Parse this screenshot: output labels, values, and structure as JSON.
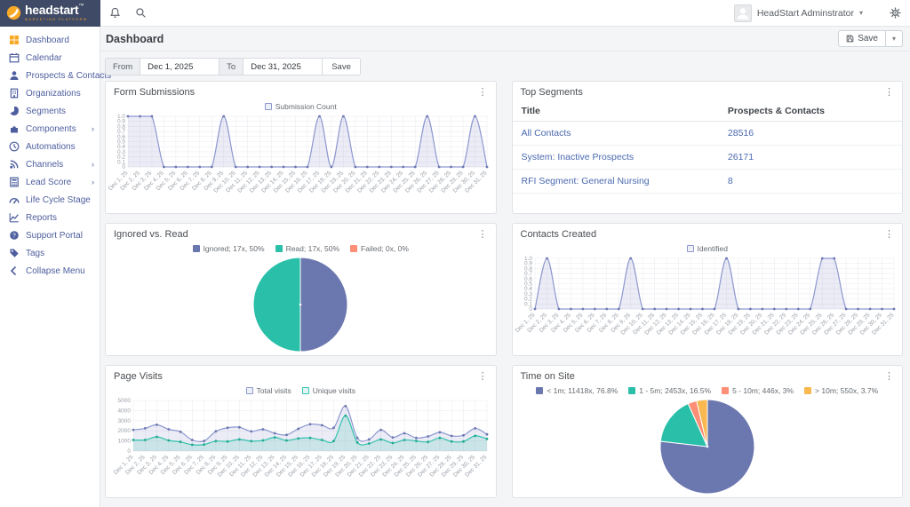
{
  "brand": {
    "name": "headstart",
    "trademark": "™",
    "tagline": "MARKETING PLATFORM"
  },
  "topbar": {
    "user": "HeadStart Adminstrator"
  },
  "sidebar": {
    "items": [
      {
        "label": "Dashboard",
        "icon": "dashboard-grid-icon",
        "active": true
      },
      {
        "label": "Calendar",
        "icon": "calendar-icon"
      },
      {
        "label": "Prospects & Contacts",
        "icon": "person-icon"
      },
      {
        "label": "Organizations",
        "icon": "building-icon"
      },
      {
        "label": "Segments",
        "icon": "pie-icon"
      },
      {
        "label": "Components",
        "icon": "puzzle-icon",
        "submenu": true
      },
      {
        "label": "Automations",
        "icon": "clock-icon"
      },
      {
        "label": "Channels",
        "icon": "broadcast-icon",
        "submenu": true
      },
      {
        "label": "Lead Score",
        "icon": "calculator-icon",
        "submenu": true
      },
      {
        "label": "Life Cycle Stage",
        "icon": "gauge-icon"
      },
      {
        "label": "Reports",
        "icon": "chart-line-icon"
      },
      {
        "label": "Support Portal",
        "icon": "help-icon"
      },
      {
        "label": "Tags",
        "icon": "tag-icon"
      },
      {
        "label": "Collapse Menu",
        "icon": "collapse-icon"
      }
    ]
  },
  "page": {
    "title": "Dashboard",
    "save_label": "Save"
  },
  "date_filter": {
    "from_label": "From",
    "from_value": "Dec 1, 2025",
    "to_label": "To",
    "to_value": "Dec 31, 2025",
    "apply_label": "Save"
  },
  "colors": {
    "purple": "#6b77af",
    "teal": "#29bfa8",
    "salmon": "#fc8f75",
    "yellow": "#f9b850",
    "line_purple": "#8e98cf",
    "accent_orange": "#f9a826",
    "sidebar_blue": "#4d5e9e",
    "link_blue": "#4a69b0"
  },
  "widgets": {
    "form_submissions": {
      "title": "Form Submissions"
    },
    "top_segments": {
      "title": "Top Segments",
      "columns": [
        "Title",
        "Prospects & Contacts"
      ],
      "rows": [
        {
          "title": "All Contacts",
          "count": "28516"
        },
        {
          "title": "System: Inactive Prospects",
          "count": "26171"
        },
        {
          "title": "RFI Segment: General Nursing",
          "count": "8"
        }
      ]
    },
    "ignored_vs_read": {
      "title": "Ignored vs. Read"
    },
    "contacts_created": {
      "title": "Contacts Created"
    },
    "page_visits": {
      "title": "Page Visits"
    },
    "time_on_site": {
      "title": "Time on Site"
    }
  },
  "x_labels": [
    "Dec 1, 25",
    "Dec 2, 25",
    "Dec 3, 25",
    "Dec 4, 25",
    "Dec 5, 25",
    "Dec 6, 25",
    "Dec 7, 25",
    "Dec 8, 25",
    "Dec 9, 25",
    "Dec 10, 25",
    "Dec 11, 25",
    "Dec 12, 25",
    "Dec 13, 25",
    "Dec 14, 25",
    "Dec 15, 25",
    "Dec 16, 25",
    "Dec 17, 25",
    "Dec 18, 25",
    "Dec 19, 25",
    "Dec 20, 25",
    "Dec 21, 25",
    "Dec 22, 25",
    "Dec 23, 25",
    "Dec 24, 25",
    "Dec 25, 25",
    "Dec 26, 25",
    "Dec 27, 25",
    "Dec 28, 25",
    "Dec 29, 25",
    "Dec 30, 25",
    "Dec 31, 25"
  ],
  "chart_data": [
    {
      "id": "form_submissions",
      "type": "area",
      "title": "Form Submissions",
      "x_ref": "x_labels",
      "ylim": [
        0,
        1
      ],
      "ystep": 0.1,
      "grid": true,
      "legend_position": "top",
      "series": [
        {
          "name": "Submission Count",
          "color": "#8e98cf",
          "point_color": "#6b77af",
          "values": [
            1,
            1,
            1,
            0,
            0,
            0,
            0,
            0,
            1,
            0,
            0,
            0,
            0,
            0,
            0,
            0,
            1,
            0,
            1,
            0,
            0,
            0,
            0,
            0,
            0,
            1,
            0,
            0,
            0,
            1,
            0
          ]
        }
      ]
    },
    {
      "id": "contacts_created",
      "type": "area",
      "title": "Contacts Created",
      "x_ref": "x_labels",
      "ylim": [
        0,
        1
      ],
      "ystep": 0.1,
      "grid": true,
      "legend_position": "top",
      "series": [
        {
          "name": "Identified",
          "color": "#8e98cf",
          "point_color": "#6b77af",
          "values": [
            0,
            1,
            0,
            0,
            0,
            0,
            0,
            0,
            1,
            0,
            0,
            0,
            0,
            0,
            0,
            0,
            1,
            0,
            0,
            0,
            0,
            0,
            0,
            0,
            1,
            1,
            0,
            0,
            0,
            0,
            0
          ]
        }
      ]
    },
    {
      "id": "page_visits",
      "type": "area",
      "title": "Page Visits",
      "x_ref": "x_labels",
      "ylim": [
        0,
        5000
      ],
      "ystep": 1000,
      "grid": true,
      "legend_position": "top",
      "series": [
        {
          "name": "Total visits",
          "color": "#8e98cf",
          "point_color": "#6b77af",
          "values": [
            2100,
            2250,
            2600,
            2150,
            1900,
            1100,
            1000,
            1950,
            2300,
            2350,
            1950,
            2150,
            1750,
            1600,
            2200,
            2650,
            2550,
            2300,
            4450,
            1300,
            1150,
            2100,
            1350,
            1750,
            1300,
            1450,
            1850,
            1500,
            1550,
            2250,
            1650
          ]
        },
        {
          "name": "Unique visits",
          "color": "#35c3ad",
          "point_color": "#20a892",
          "values": [
            1100,
            1100,
            1400,
            1050,
            900,
            620,
            650,
            980,
            950,
            1150,
            980,
            1050,
            1350,
            1050,
            1250,
            1300,
            1100,
            1000,
            3500,
            850,
            750,
            1150,
            800,
            1100,
            1000,
            900,
            1300,
            950,
            950,
            1500,
            1200
          ]
        }
      ]
    },
    {
      "id": "ignored_vs_read",
      "type": "pie",
      "title": "Ignored vs. Read",
      "legend_position": "top",
      "slices": [
        {
          "label": "Ignored; 17x, 50%",
          "value": 50,
          "color": "#6b77af"
        },
        {
          "label": "Read; 17x, 50%",
          "value": 50,
          "color": "#29bfa8"
        },
        {
          "label": "Failed; 0x, 0%",
          "value": 0,
          "color": "#fc8f75"
        }
      ]
    },
    {
      "id": "time_on_site",
      "type": "pie",
      "title": "Time on Site",
      "legend_position": "top",
      "slices": [
        {
          "label": "< 1m; 11418x, 76.8%",
          "value": 76.8,
          "color": "#6b77af"
        },
        {
          "label": "1 - 5m; 2453x, 16.5%",
          "value": 16.5,
          "color": "#29bfa8"
        },
        {
          "label": "5 - 10m; 446x, 3%",
          "value": 3,
          "color": "#fc8f75"
        },
        {
          "label": "> 10m; 550x, 3.7%",
          "value": 3.7,
          "color": "#f9b850"
        }
      ]
    }
  ]
}
